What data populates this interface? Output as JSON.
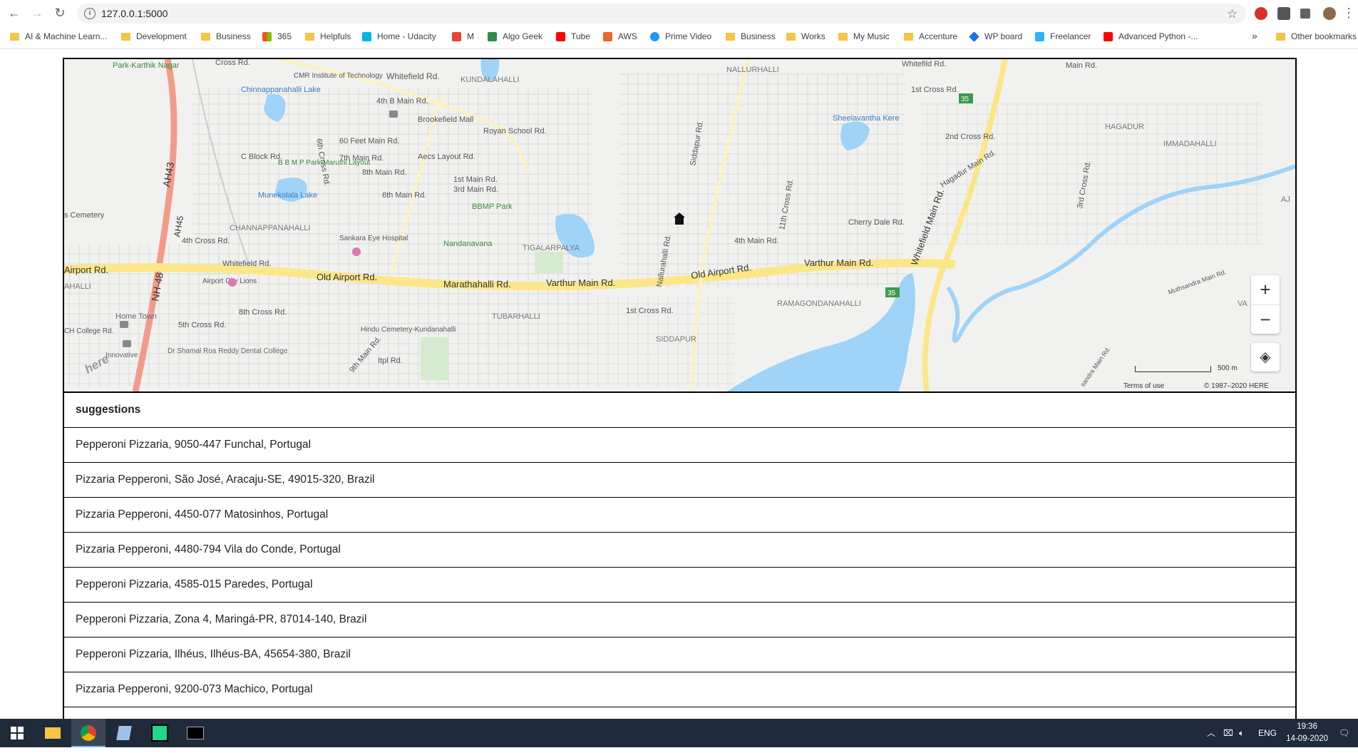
{
  "browser": {
    "url": "127.0.0.1:5000",
    "bookmarks": [
      {
        "label": "AI & Machine Learn...",
        "icon": "folder"
      },
      {
        "label": "Development",
        "icon": "folder"
      },
      {
        "label": "Business",
        "icon": "folder"
      },
      {
        "label": "365",
        "icon": "microsoft-icon"
      },
      {
        "label": "Helpfuls",
        "icon": "folder"
      },
      {
        "label": "Home - Udacity",
        "icon": "udacity-icon"
      },
      {
        "label": "M",
        "icon": "gmail-icon"
      },
      {
        "label": "Algo Geek",
        "icon": "geeksforgeeks-icon"
      },
      {
        "label": "Tube",
        "icon": "youtube-icon"
      },
      {
        "label": "AWS",
        "icon": "aws-icon"
      },
      {
        "label": "Prime Video",
        "icon": "prime-video-icon"
      },
      {
        "label": "Business",
        "icon": "folder"
      },
      {
        "label": "Works",
        "icon": "folder"
      },
      {
        "label": "My Music",
        "icon": "folder"
      },
      {
        "label": "Accenture",
        "icon": "folder"
      },
      {
        "label": "WP board",
        "icon": "wp-icon"
      },
      {
        "label": "Freelancer",
        "icon": "freelancer-icon"
      },
      {
        "label": "Advanced Python -...",
        "icon": "youtube-icon"
      }
    ],
    "overflow": "»",
    "other_bookmarks": "Other bookmarks"
  },
  "map": {
    "labels": {
      "park_karthik_nagar": "Park-Karthik Nagar",
      "cross_rd_top": "Cross Rd.",
      "cmr": "CMR Institute of Technology",
      "whitefield_rd_top": "Whitefield Rd.",
      "kundalahalli": "KUNDALAHALLI",
      "nallurhalli": "NALLURHALLI",
      "whitefild_rd": "Whitefild Rd.",
      "first_cross_rd": "1st Cross Rd.",
      "main_rd_tr": "Main Rd.",
      "chinnappanahalli_lake": "Chinnappanahalli Lake",
      "fourth_b_main": "4th B Main Rd.",
      "brookefield_mall": "Brookefield Mall",
      "royan_school": "Royan School Rd.",
      "sixth_cross": "6th Cross Rd.",
      "sixty_feet": "60 Feet Main Rd.",
      "siddapur_rd": "Siddapur Rd.",
      "sheelavantha": "Sheelavantha Kere",
      "second_cross": "2nd Cross Rd.",
      "hagadur": "HAGADUR",
      "immadahalli": "IMMADAHALLI",
      "c_block": "C Block Rd.",
      "bbmp_layout": "B B M P Park-Maruthi Layout",
      "seventh_main": "7th Main Rd.",
      "aecs": "Aecs Layout Rd.",
      "hagadur_main": "Hagadur Main Rd.",
      "eighth_main": "8th Main Rd.",
      "first_main": "1st Main Rd.",
      "third_main": "3rd Main Rd.",
      "munekolala": "Munekolala Lake",
      "sixth_main": "6th Main Rd.",
      "bbmp_park": "BBMP Park",
      "cemetery": "s Cemetery",
      "channappanahalli": "CHANNAPPANAHALLI",
      "ah43": "AH43",
      "ah45": "AH45",
      "nh48": "NH-48",
      "cherry_dale": "Cherry Dale Rd.",
      "fourth_main": "4th Main Rd.",
      "eleventh_cross": "11th Cross Rd.",
      "sankara": "Sankara Eye Hospital",
      "nandanavana": "Nandanavana",
      "tigalarpalya": "TIGALARPALYA",
      "fourth_cross": "4th Cross Rd.",
      "whitefield_main": "Whitefield Main Rd.",
      "airport_rd": "Airport Rd.",
      "whitefield_rd_mid": "Whitefield Rd.",
      "old_airport_left": "Old Airport Rd.",
      "marathahalli": "Marathahalli Rd.",
      "varthur_main_left": "Varthur Main Rd.",
      "old_airport_right": "Old Airport Rd.",
      "varthur_main_right": "Varthur Main Rd.",
      "nallurahalli_rd": "Nallurahalli Rd.",
      "ahalli": "AHALLI",
      "airport_city_lions": "Airport City Lions",
      "ramagondanahalli": "RAMAGONDANAHALLI",
      "muthsandra": "Muthsandra Main Rd.",
      "varthur": "VA",
      "first_cross_low": "1st Cross Rd.",
      "tubarhalli": "TUBARHALLI",
      "eighth_cross": "8th Cross Rd.",
      "fifth_cross": "5th Cross Rd.",
      "home_town": "Home Town",
      "hindu_cemetery": "Hindu Cemetery-Kundanahalli",
      "college_rd": "CH College Rd.",
      "siddapur": "SIDDAPUR",
      "innovative": "Innovative",
      "shamal": "Dr Shamal Roa Reddy Dental College",
      "ninth_main": "9th Main Rd.",
      "itpl": "Itpl Rd.",
      "sandra_main": "sandra Main Rd.",
      "third_cross": "3rd Cross Rd.",
      "aj": "AJ",
      "shield_35": "35",
      "here": "here"
    },
    "zoom_in": "+",
    "zoom_out": "−",
    "scale": "500 m",
    "terms": "Terms of use",
    "copyright": "© 1987–2020 HERE"
  },
  "suggestions": {
    "header": "suggestions",
    "items": [
      "Pepperoni Pizzaria, 9050-447 Funchal, Portugal",
      "Pizzaria Pepperoni, São José, Aracaju-SE, 49015-320, Brazil",
      "Pizzaria Pepperoni, 4450-077 Matosinhos, Portugal",
      "Pizzaria Pepperoni, 4480-794 Vila do Conde, Portugal",
      "Pepperoni Pizzaria, 4585-015 Paredes, Portugal",
      "Pepperoni Pizzaria, Zona 4, Maringá-PR, 87014-140, Brazil",
      "Pepperoni Pizzaria, Ilhéus, Ilhéus-BA, 45654-380, Brazil",
      "Pizzaria Pepperoni, 9200-073 Machico, Portugal"
    ]
  },
  "taskbar": {
    "language": "ENG",
    "time": "19:36",
    "date": "14-09-2020"
  }
}
